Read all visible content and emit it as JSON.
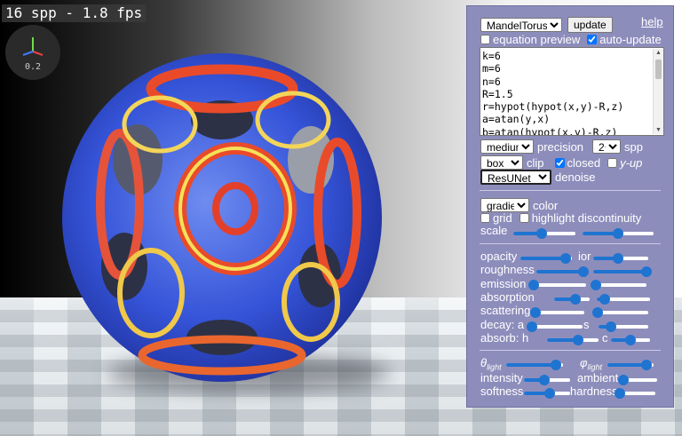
{
  "overlay": {
    "fps_text": "16 spp - 1.8 fps",
    "gizmo_scale": "0.2"
  },
  "panel": {
    "function_select": "MandelTorus",
    "update_label": "update",
    "help_label": "help",
    "equation_preview": {
      "label": "equation preview",
      "checked": false
    },
    "auto_update": {
      "label": "auto-update",
      "checked": true
    },
    "equation_lines": [
      "k=6",
      "m=6",
      "n=6",
      "R=1.5",
      "r=hypot(hypot(x,y)-R,z)",
      "a=atan(y,x)",
      "b=atan(hypot(x,y)-R,z)"
    ],
    "precision_select": "medium",
    "precision_label": "precision",
    "spp_select": "2⁴",
    "spp_label": "spp",
    "clip_select": "box",
    "clip_label": "clip",
    "closed": {
      "label": "closed",
      "checked": true
    },
    "yup": {
      "label": "y-up",
      "checked": false
    },
    "denoise_select": "ResUNet",
    "denoise_label": "denoise",
    "color_select": "gradient",
    "color_label": "color",
    "grid": {
      "label": "grid",
      "checked": false
    },
    "highlight": {
      "label": "highlight discontinuity",
      "checked": false
    },
    "scale_label": "scale",
    "sliders": {
      "scale_a": 0.45,
      "scale_b": 0.5,
      "opacity": 0.88,
      "ior": 0.45,
      "roughness": 0.92,
      "roughness_b": 0.97,
      "emission": 0.05,
      "emission_b": 0.08,
      "absorption": 0.6,
      "absorption_b": 0.15,
      "scattering": 0.05,
      "scattering_b": 0.08,
      "decay_a": 0.05,
      "decay_s": 0.25,
      "absorb_h": 0.6,
      "absorb_c": 0.5,
      "theta_light": 0.88,
      "phi_light": 0.85,
      "intensity": 0.45,
      "ambient": 0.1,
      "softness": 0.55,
      "hardness": 0.05
    },
    "labels": {
      "opacity": "opacity",
      "ior": "ior",
      "roughness": "roughness",
      "emission": "emission",
      "absorption": "absorption",
      "scattering": "scattering",
      "decay_a": "decay: a",
      "decay_s": "s",
      "absorb_h": "absorb: h",
      "absorb_c": "c",
      "theta": "θ",
      "theta_sub": "light",
      "phi": "φ",
      "phi_sub": "light",
      "intensity": "intensity",
      "ambient": "ambient",
      "softness": "softness",
      "hardness": "hardness"
    },
    "colors": {
      "panel_bg": "#8d8dbc",
      "slider_accent": "#1f74d1"
    }
  }
}
